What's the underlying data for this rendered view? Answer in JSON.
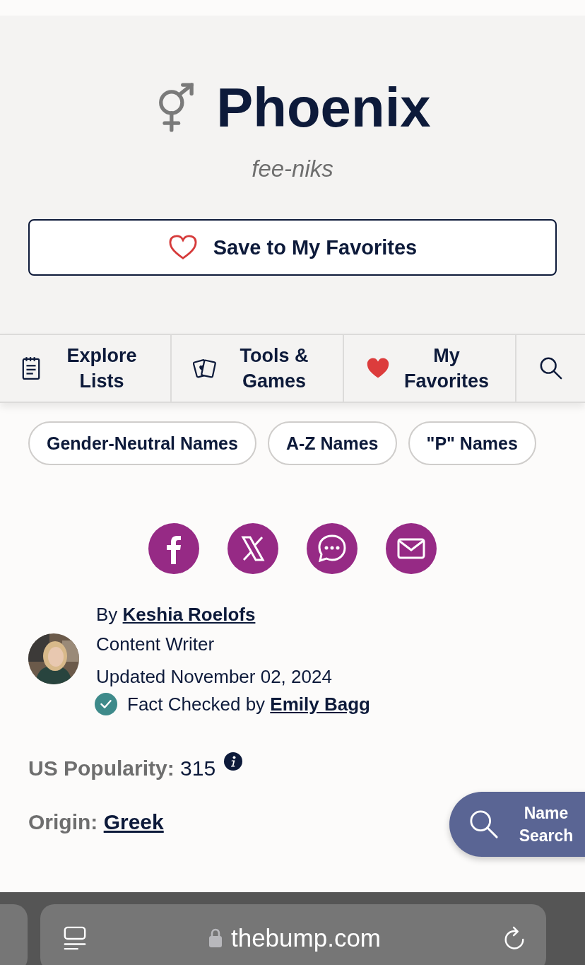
{
  "name": {
    "title": "Phoenix",
    "pronunciation": "fee-niks"
  },
  "save_button": {
    "label": "Save to My Favorites"
  },
  "nav": [
    {
      "kind": "lists",
      "label": "Explore Lists"
    },
    {
      "kind": "games",
      "label": "Tools & Games"
    },
    {
      "kind": "favorites",
      "label": "My Favorites"
    },
    {
      "kind": "search"
    }
  ],
  "tags": [
    "Gender-Neutral Names",
    "A-Z Names",
    "\"P\" Names"
  ],
  "share": [
    {
      "kind": "facebook"
    },
    {
      "kind": "x"
    },
    {
      "kind": "message"
    },
    {
      "kind": "email"
    }
  ],
  "author": {
    "by": "By",
    "name": "Keshia Roelofs",
    "role": "Content Writer",
    "updated": "Updated November 02, 2024",
    "fact_checked": "Fact Checked by",
    "checker": "Emily Bagg"
  },
  "facts": [
    {
      "label": "US Popularity:",
      "value": "315",
      "kind": "info"
    },
    {
      "label": "Origin:",
      "value": "Greek",
      "kind": "link"
    }
  ],
  "name_search": {
    "label": "Name Search"
  },
  "browser": {
    "url": "thebump.com"
  }
}
